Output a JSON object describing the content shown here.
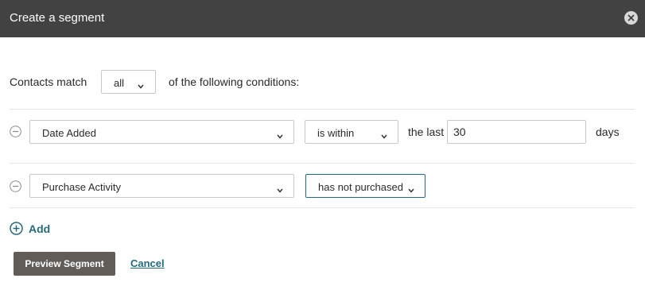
{
  "dialog": {
    "title": "Create a segment",
    "close_icon": "close-icon"
  },
  "match": {
    "prefix": "Contacts match",
    "selected": "all",
    "suffix": "of the following conditions:"
  },
  "conditions": [
    {
      "field": "Date Added",
      "operator": "is within",
      "before_value": "the last",
      "value": "30",
      "after_value": "days"
    },
    {
      "field": "Purchase Activity",
      "operator": "has not purchased"
    }
  ],
  "actions": {
    "add_label": "Add",
    "preview_label": "Preview Segment",
    "cancel_label": "Cancel"
  },
  "colors": {
    "header_bg": "#424242",
    "accent": "#26697a",
    "primary_button_bg": "#615c57"
  }
}
